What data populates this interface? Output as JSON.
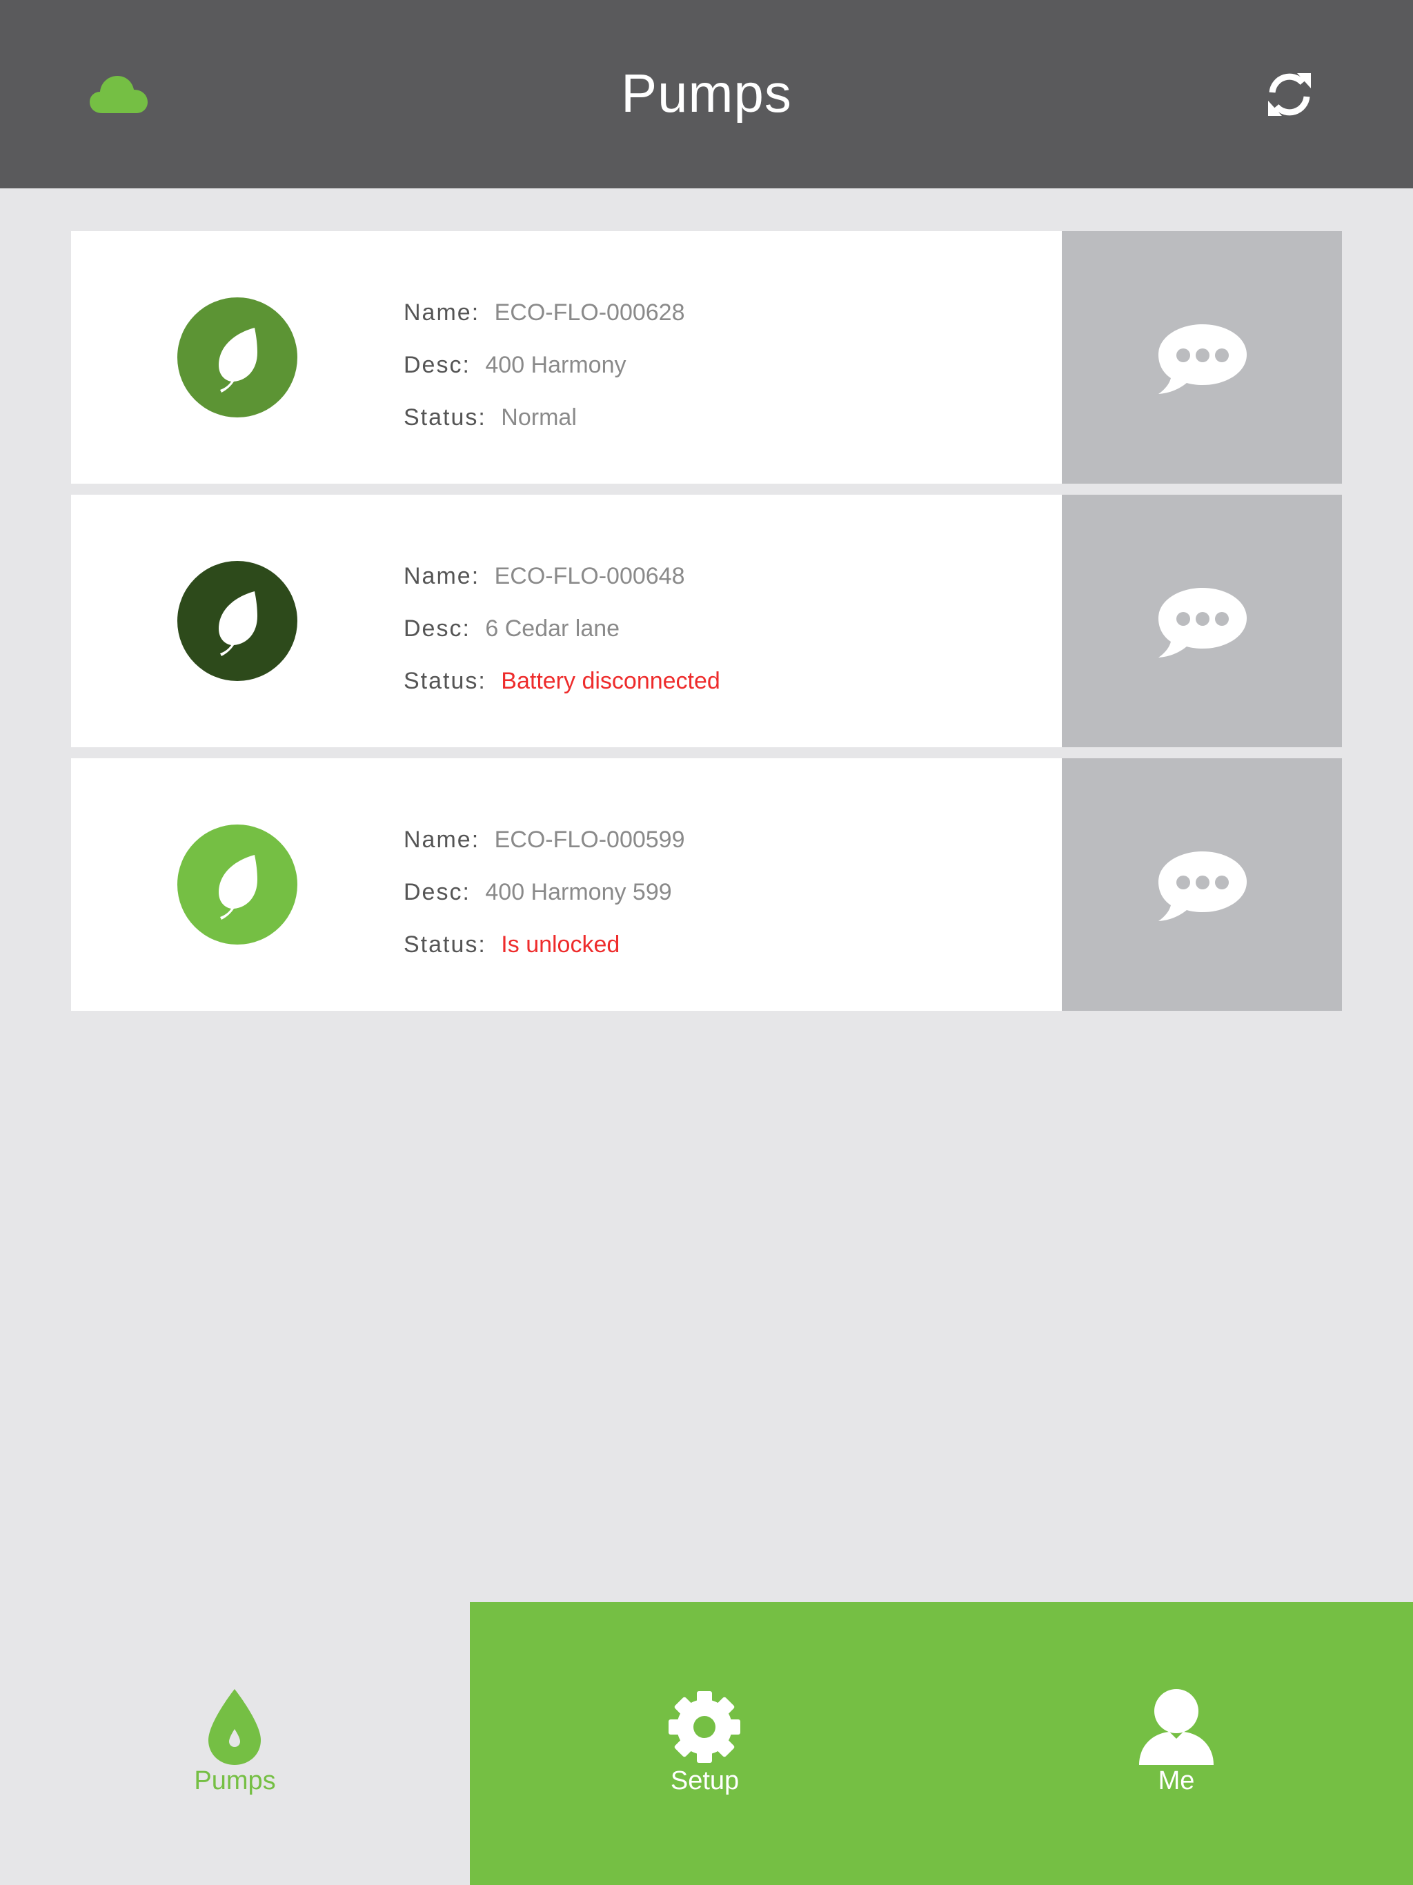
{
  "header": {
    "title": "Pumps",
    "left_icon": "cloud-icon",
    "right_icon": "refresh-icon"
  },
  "pumps": [
    {
      "name_label": "Name:",
      "name": "ECO-FLO-000628",
      "desc_label": "Desc:",
      "desc": "400 Harmony",
      "status_label": "Status:",
      "status": "Normal",
      "status_alert": false,
      "avatar_color": "#5c9434",
      "icon": "leaf-icon",
      "action_icon": "chat-bubble-icon"
    },
    {
      "name_label": "Name:",
      "name": "ECO-FLO-000648",
      "desc_label": "Desc:",
      "desc": "6 Cedar lane",
      "status_label": "Status:",
      "status": "Battery disconnected",
      "status_alert": true,
      "avatar_color": "#2d4a1b",
      "icon": "leaf-icon",
      "action_icon": "chat-bubble-icon"
    },
    {
      "name_label": "Name:",
      "name": "ECO-FLO-000599",
      "desc_label": "Desc:",
      "desc": "400 Harmony 599",
      "status_label": "Status:",
      "status": "Is unlocked",
      "status_alert": true,
      "avatar_color": "#75bf44",
      "icon": "leaf-icon",
      "action_icon": "chat-bubble-icon"
    }
  ],
  "tabs": [
    {
      "label": "Pumps",
      "icon": "water-drop-icon",
      "active": true
    },
    {
      "label": "Setup",
      "icon": "gear-icon",
      "active": false
    },
    {
      "label": "Me",
      "icon": "user-icon",
      "active": false
    }
  ],
  "colors": {
    "header_bg": "#5a5a5c",
    "brand_green": "#75bf44",
    "alert_red": "#ee2c2c",
    "page_bg": "#e6e6e8",
    "panel_gray": "#bbbcbf"
  }
}
